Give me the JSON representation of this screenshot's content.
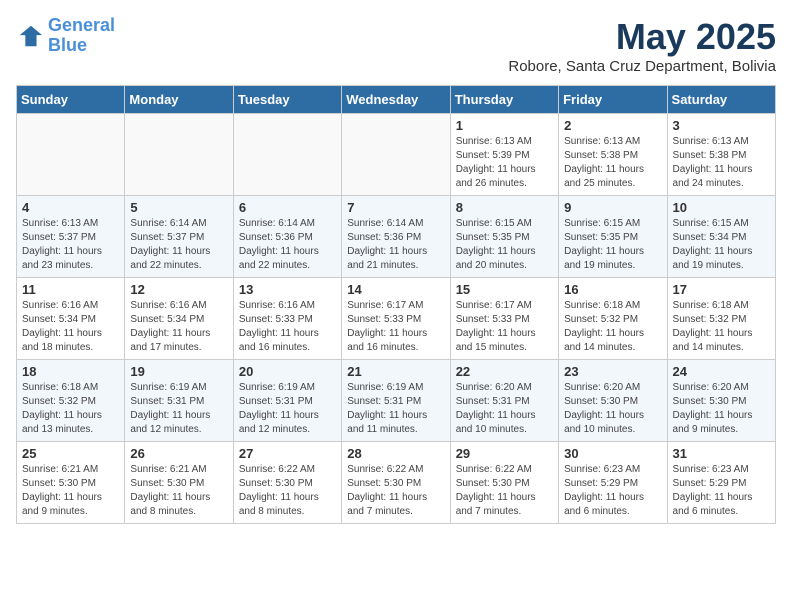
{
  "logo": {
    "line1": "General",
    "line2": "Blue"
  },
  "title": "May 2025",
  "location": "Robore, Santa Cruz Department, Bolivia",
  "weekdays": [
    "Sunday",
    "Monday",
    "Tuesday",
    "Wednesday",
    "Thursday",
    "Friday",
    "Saturday"
  ],
  "weeks": [
    [
      {
        "day": "",
        "info": ""
      },
      {
        "day": "",
        "info": ""
      },
      {
        "day": "",
        "info": ""
      },
      {
        "day": "",
        "info": ""
      },
      {
        "day": "1",
        "info": "Sunrise: 6:13 AM\nSunset: 5:39 PM\nDaylight: 11 hours\nand 26 minutes."
      },
      {
        "day": "2",
        "info": "Sunrise: 6:13 AM\nSunset: 5:38 PM\nDaylight: 11 hours\nand 25 minutes."
      },
      {
        "day": "3",
        "info": "Sunrise: 6:13 AM\nSunset: 5:38 PM\nDaylight: 11 hours\nand 24 minutes."
      }
    ],
    [
      {
        "day": "4",
        "info": "Sunrise: 6:13 AM\nSunset: 5:37 PM\nDaylight: 11 hours\nand 23 minutes."
      },
      {
        "day": "5",
        "info": "Sunrise: 6:14 AM\nSunset: 5:37 PM\nDaylight: 11 hours\nand 22 minutes."
      },
      {
        "day": "6",
        "info": "Sunrise: 6:14 AM\nSunset: 5:36 PM\nDaylight: 11 hours\nand 22 minutes."
      },
      {
        "day": "7",
        "info": "Sunrise: 6:14 AM\nSunset: 5:36 PM\nDaylight: 11 hours\nand 21 minutes."
      },
      {
        "day": "8",
        "info": "Sunrise: 6:15 AM\nSunset: 5:35 PM\nDaylight: 11 hours\nand 20 minutes."
      },
      {
        "day": "9",
        "info": "Sunrise: 6:15 AM\nSunset: 5:35 PM\nDaylight: 11 hours\nand 19 minutes."
      },
      {
        "day": "10",
        "info": "Sunrise: 6:15 AM\nSunset: 5:34 PM\nDaylight: 11 hours\nand 19 minutes."
      }
    ],
    [
      {
        "day": "11",
        "info": "Sunrise: 6:16 AM\nSunset: 5:34 PM\nDaylight: 11 hours\nand 18 minutes."
      },
      {
        "day": "12",
        "info": "Sunrise: 6:16 AM\nSunset: 5:34 PM\nDaylight: 11 hours\nand 17 minutes."
      },
      {
        "day": "13",
        "info": "Sunrise: 6:16 AM\nSunset: 5:33 PM\nDaylight: 11 hours\nand 16 minutes."
      },
      {
        "day": "14",
        "info": "Sunrise: 6:17 AM\nSunset: 5:33 PM\nDaylight: 11 hours\nand 16 minutes."
      },
      {
        "day": "15",
        "info": "Sunrise: 6:17 AM\nSunset: 5:33 PM\nDaylight: 11 hours\nand 15 minutes."
      },
      {
        "day": "16",
        "info": "Sunrise: 6:18 AM\nSunset: 5:32 PM\nDaylight: 11 hours\nand 14 minutes."
      },
      {
        "day": "17",
        "info": "Sunrise: 6:18 AM\nSunset: 5:32 PM\nDaylight: 11 hours\nand 14 minutes."
      }
    ],
    [
      {
        "day": "18",
        "info": "Sunrise: 6:18 AM\nSunset: 5:32 PM\nDaylight: 11 hours\nand 13 minutes."
      },
      {
        "day": "19",
        "info": "Sunrise: 6:19 AM\nSunset: 5:31 PM\nDaylight: 11 hours\nand 12 minutes."
      },
      {
        "day": "20",
        "info": "Sunrise: 6:19 AM\nSunset: 5:31 PM\nDaylight: 11 hours\nand 12 minutes."
      },
      {
        "day": "21",
        "info": "Sunrise: 6:19 AM\nSunset: 5:31 PM\nDaylight: 11 hours\nand 11 minutes."
      },
      {
        "day": "22",
        "info": "Sunrise: 6:20 AM\nSunset: 5:31 PM\nDaylight: 11 hours\nand 10 minutes."
      },
      {
        "day": "23",
        "info": "Sunrise: 6:20 AM\nSunset: 5:30 PM\nDaylight: 11 hours\nand 10 minutes."
      },
      {
        "day": "24",
        "info": "Sunrise: 6:20 AM\nSunset: 5:30 PM\nDaylight: 11 hours\nand 9 minutes."
      }
    ],
    [
      {
        "day": "25",
        "info": "Sunrise: 6:21 AM\nSunset: 5:30 PM\nDaylight: 11 hours\nand 9 minutes."
      },
      {
        "day": "26",
        "info": "Sunrise: 6:21 AM\nSunset: 5:30 PM\nDaylight: 11 hours\nand 8 minutes."
      },
      {
        "day": "27",
        "info": "Sunrise: 6:22 AM\nSunset: 5:30 PM\nDaylight: 11 hours\nand 8 minutes."
      },
      {
        "day": "28",
        "info": "Sunrise: 6:22 AM\nSunset: 5:30 PM\nDaylight: 11 hours\nand 7 minutes."
      },
      {
        "day": "29",
        "info": "Sunrise: 6:22 AM\nSunset: 5:30 PM\nDaylight: 11 hours\nand 7 minutes."
      },
      {
        "day": "30",
        "info": "Sunrise: 6:23 AM\nSunset: 5:29 PM\nDaylight: 11 hours\nand 6 minutes."
      },
      {
        "day": "31",
        "info": "Sunrise: 6:23 AM\nSunset: 5:29 PM\nDaylight: 11 hours\nand 6 minutes."
      }
    ]
  ]
}
